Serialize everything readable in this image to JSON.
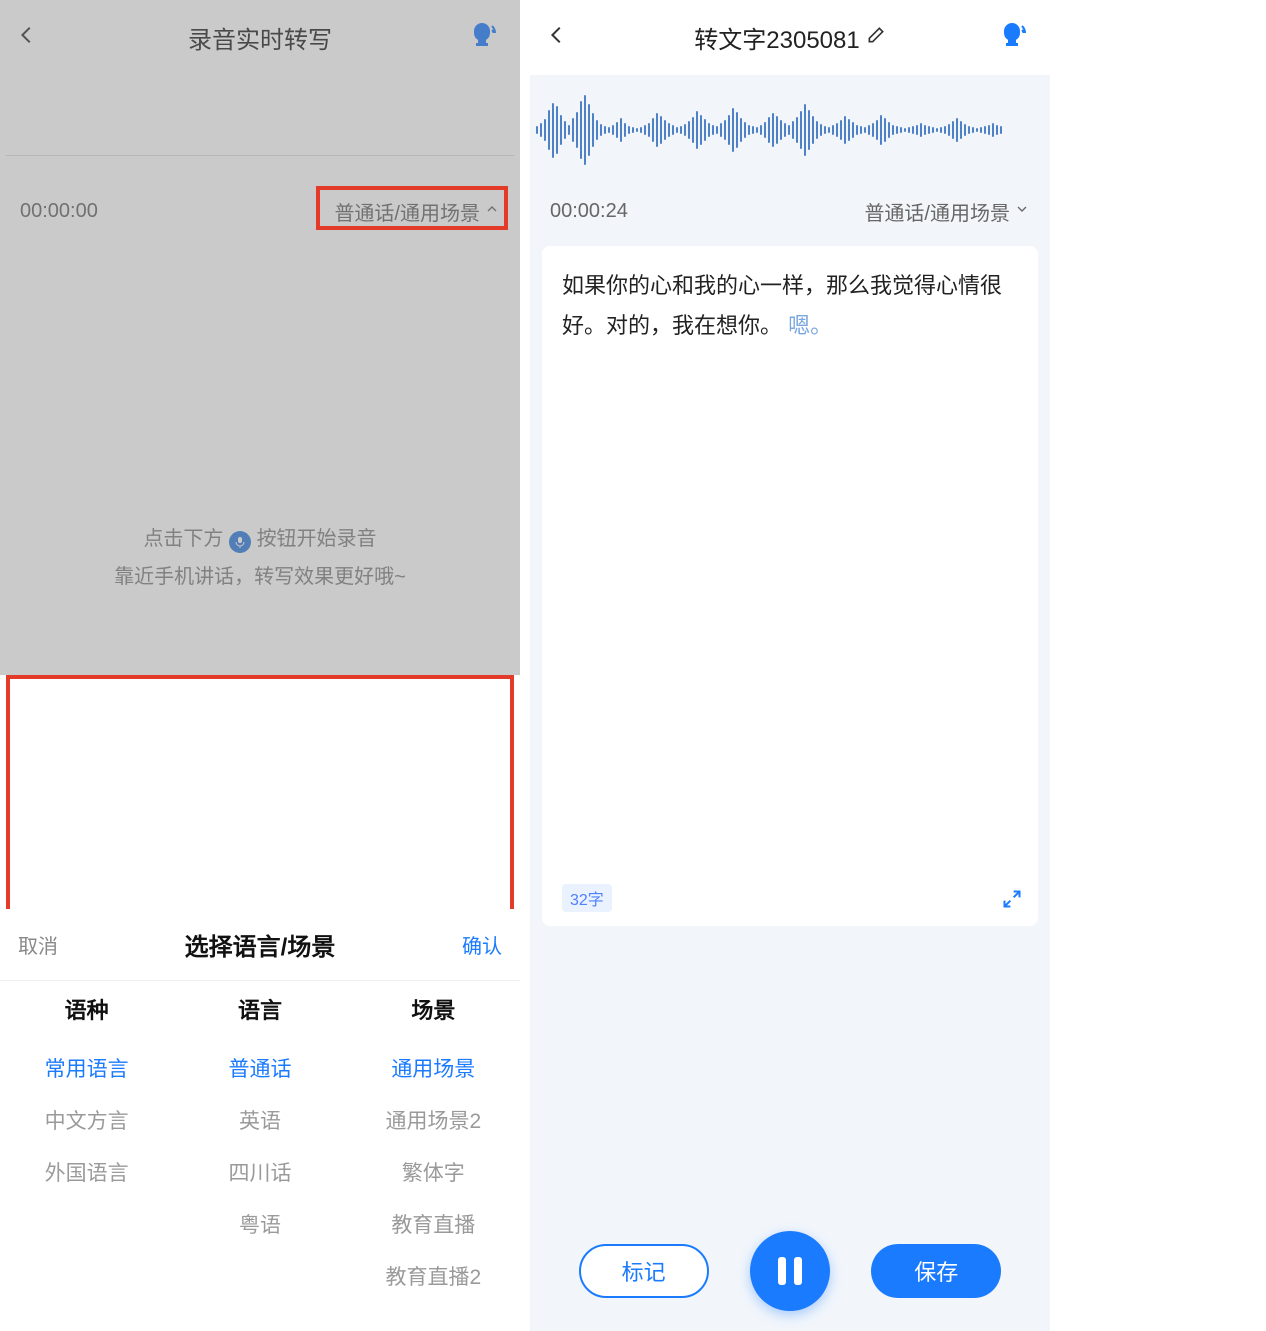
{
  "left": {
    "header": {
      "title": "录音实时转写"
    },
    "info": {
      "time": "00:00:00",
      "lang": "普通话/通用场景"
    },
    "hint": {
      "line1a": "点击下方",
      "line1b": "按钮开始录音",
      "line2": "靠近手机讲话，转写效果更好哦~"
    },
    "sheet": {
      "cancel": "取消",
      "title": "选择语言/场景",
      "confirm": "确认",
      "col_heads": {
        "type": "语种",
        "lang": "语言",
        "scene": "场景"
      },
      "type": [
        "常用语言",
        "中文方言",
        "外国语言"
      ],
      "lang": [
        "普通话",
        "英语",
        "四川话",
        "粤语"
      ],
      "scene": [
        "通用场景",
        "通用场景2",
        "繁体字",
        "教育直播",
        "教育直播2"
      ]
    }
  },
  "right": {
    "header": {
      "title": "转文字2305081"
    },
    "info": {
      "time": "00:00:24",
      "lang": "普通话/通用场景"
    },
    "transcript": {
      "main": "如果你的心和我的心一样，那么我觉得心情很好。对的，我在想你。",
      "hint": "嗯。"
    },
    "count": "32字",
    "actions": {
      "mark": "标记",
      "save": "保存"
    }
  }
}
